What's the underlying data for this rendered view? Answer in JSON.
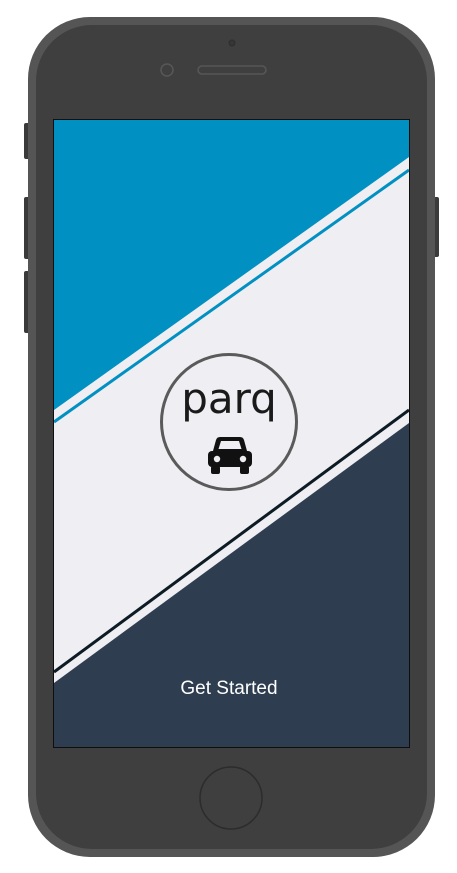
{
  "app": {
    "logo_text": "parq",
    "logo_icon": "car-icon",
    "cta_label": "Get Started"
  },
  "colors": {
    "top_band": "#0190c2",
    "middle_band": "#eeeef3",
    "bottom_band": "#2e3e50",
    "divider_dark": "#0d1b24",
    "device_body": "#4f4f4f",
    "device_inner": "#3f3f3f"
  }
}
